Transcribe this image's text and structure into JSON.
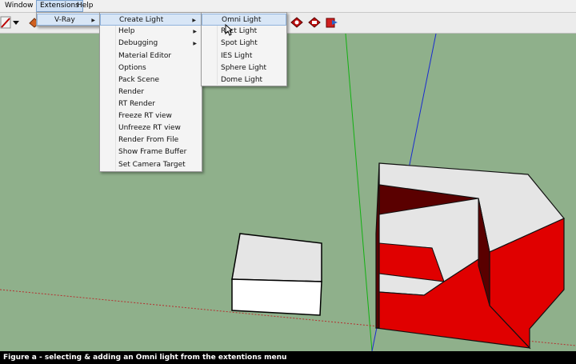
{
  "menubar": {
    "items": [
      {
        "label": "Window"
      },
      {
        "label": "Extensions"
      },
      {
        "label": "Help"
      }
    ]
  },
  "extensions_menu": {
    "items": [
      {
        "label": "V-Ray",
        "submenu": true
      }
    ]
  },
  "vray_menu": {
    "items": [
      {
        "label": "Create Light",
        "submenu": true
      },
      {
        "label": "Help",
        "submenu": true
      },
      {
        "label": "Debugging",
        "submenu": true
      },
      {
        "label": "Material Editor"
      },
      {
        "label": "Options"
      },
      {
        "label": "Pack Scene"
      },
      {
        "label": "Render"
      },
      {
        "label": "RT Render"
      },
      {
        "label": "Freeze RT view"
      },
      {
        "label": "Unfreeze RT view"
      },
      {
        "label": "Render From File"
      },
      {
        "label": "Show Frame Buffer"
      },
      {
        "label": "Set Camera Target"
      }
    ]
  },
  "create_light_menu": {
    "items": [
      {
        "label": "Omni Light"
      },
      {
        "label": "Rect Light"
      },
      {
        "label": "Spot Light"
      },
      {
        "label": "IES Light"
      },
      {
        "label": "Sphere Light"
      },
      {
        "label": "Dome Light"
      }
    ]
  },
  "caption": "Figure a - selecting & adding an Omni light from the extentions menu",
  "colors": {
    "sky": "#8fb08b",
    "highlight": "#d8e6f6",
    "cube_top": "#e5e5e5",
    "cube_side_red": "#e00000",
    "cube_dark_red": "#5a0000"
  }
}
